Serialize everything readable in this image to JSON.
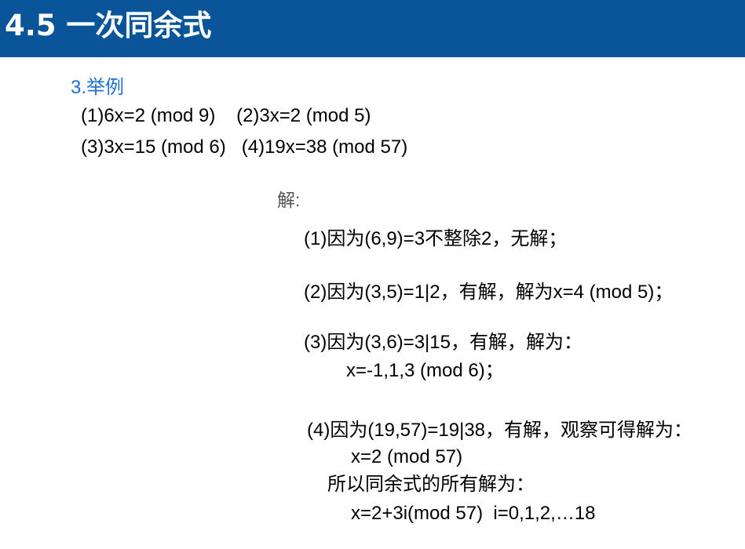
{
  "header": {
    "title": "4.5 一次同余式"
  },
  "section": {
    "heading": "3.举例",
    "examples_line1": "(1)6x=2 (mod 9)    (2)3x=2 (mod 5)",
    "examples_line2": "(3)3x=15 (mod 6)   (4)19x=38 (mod 57)"
  },
  "solution": {
    "label": "解:",
    "s1": "(1)因为(6,9)=3不整除2，无解；",
    "s2": "(2)因为(3,5)=1|2，有解，解为x=4 (mod 5)；",
    "s3_line1": "(3)因为(3,6)=3|15，有解，解为：",
    "s3_line2": "x=-1,1,3 (mod 6)；",
    "s4_line1": "(4)因为(19,57)=19|38，有解，观察可得解为：",
    "s4_line2": "x=2 (mod 57)",
    "s4_line3": "所以同余式的所有解为：",
    "s4_line4": "x=2+3i(mod 57)  i=0,1,2,…18"
  },
  "colors": {
    "header_bg": "#0a5499",
    "header_text": "#ffffff",
    "section_heading": "#1f6fd0",
    "label_gray": "#555555"
  }
}
